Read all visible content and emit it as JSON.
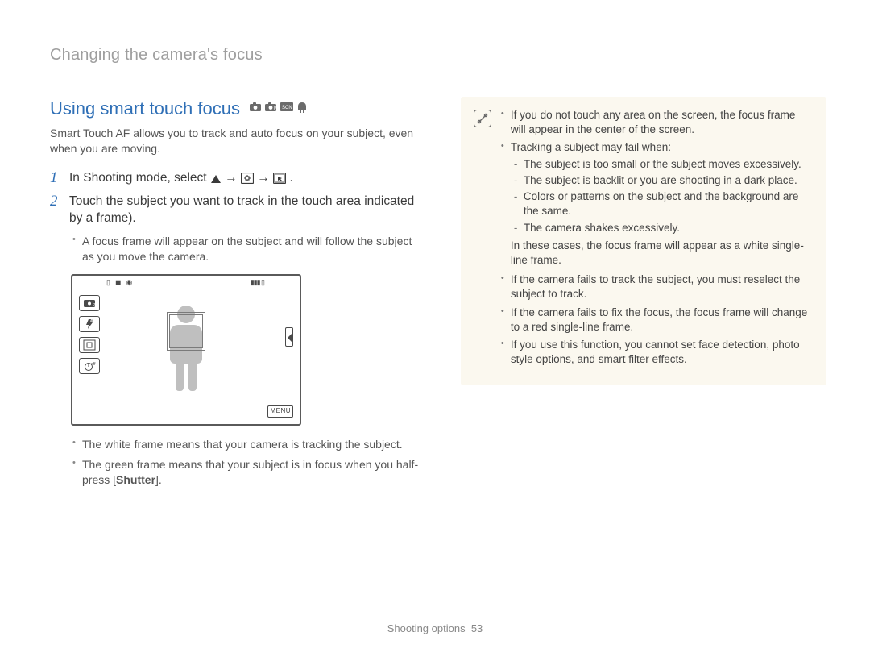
{
  "breadcrumb": "Changing the camera's focus",
  "section_title": "Using smart touch focus",
  "mode_icons": [
    "camera-icon",
    "camera-p-icon",
    "scene-icon",
    "dual-is-icon"
  ],
  "intro": "Smart Touch AF allows you to track and auto focus on your subject, even when you are moving.",
  "steps": [
    {
      "num": "1",
      "text_before": "In Shooting mode, select ",
      "seq_icons": [
        "up-triangle-icon",
        "arrow-right",
        "focus-frame-icon",
        "arrow-right",
        "smart-touch-af-icon"
      ],
      "text_after": "."
    },
    {
      "num": "2",
      "text": "Touch the subject you want to track in the touch area indicated by a frame).",
      "sub_before": [
        "A focus frame will appear on the subject and will follow the subject as you move the camera."
      ],
      "sub_after": [
        "The white frame means that your camera is tracking the subject.",
        {
          "pre": "The green frame means that your subject is in focus when you half-press [",
          "bold": "Shutter",
          "post": "]."
        }
      ]
    }
  ],
  "camera_screen": {
    "side_buttons": [
      "mode-p-icon",
      "flash-auto-icon",
      "focus-icon",
      "timer-off-icon"
    ],
    "menu_label": "MENU",
    "top_icons": [
      "sd-icon",
      "rec-icon",
      "mic-icon"
    ],
    "battery_icon": "battery-icon"
  },
  "note": {
    "items": [
      "If you do not touch any area on the screen, the focus frame will appear in the center of the screen.",
      {
        "lead": "Tracking a subject may fail when:",
        "dashes": [
          "The subject is too small or the subject moves excessively.",
          "The subject is backlit or you are shooting in a dark place.",
          "Colors or patterns on the subject and the background are the same.",
          "The camera shakes excessively."
        ],
        "tail": "In these cases, the focus frame will appear as a white single-line frame."
      },
      "If the camera fails to track the subject, you must reselect the subject to track.",
      "If the camera fails to fix the focus, the focus frame will change to a red single-line frame.",
      "If you use this function, you cannot set face detection, photo style options, and smart filter effects."
    ]
  },
  "footer": {
    "section": "Shooting options",
    "page": "53"
  }
}
